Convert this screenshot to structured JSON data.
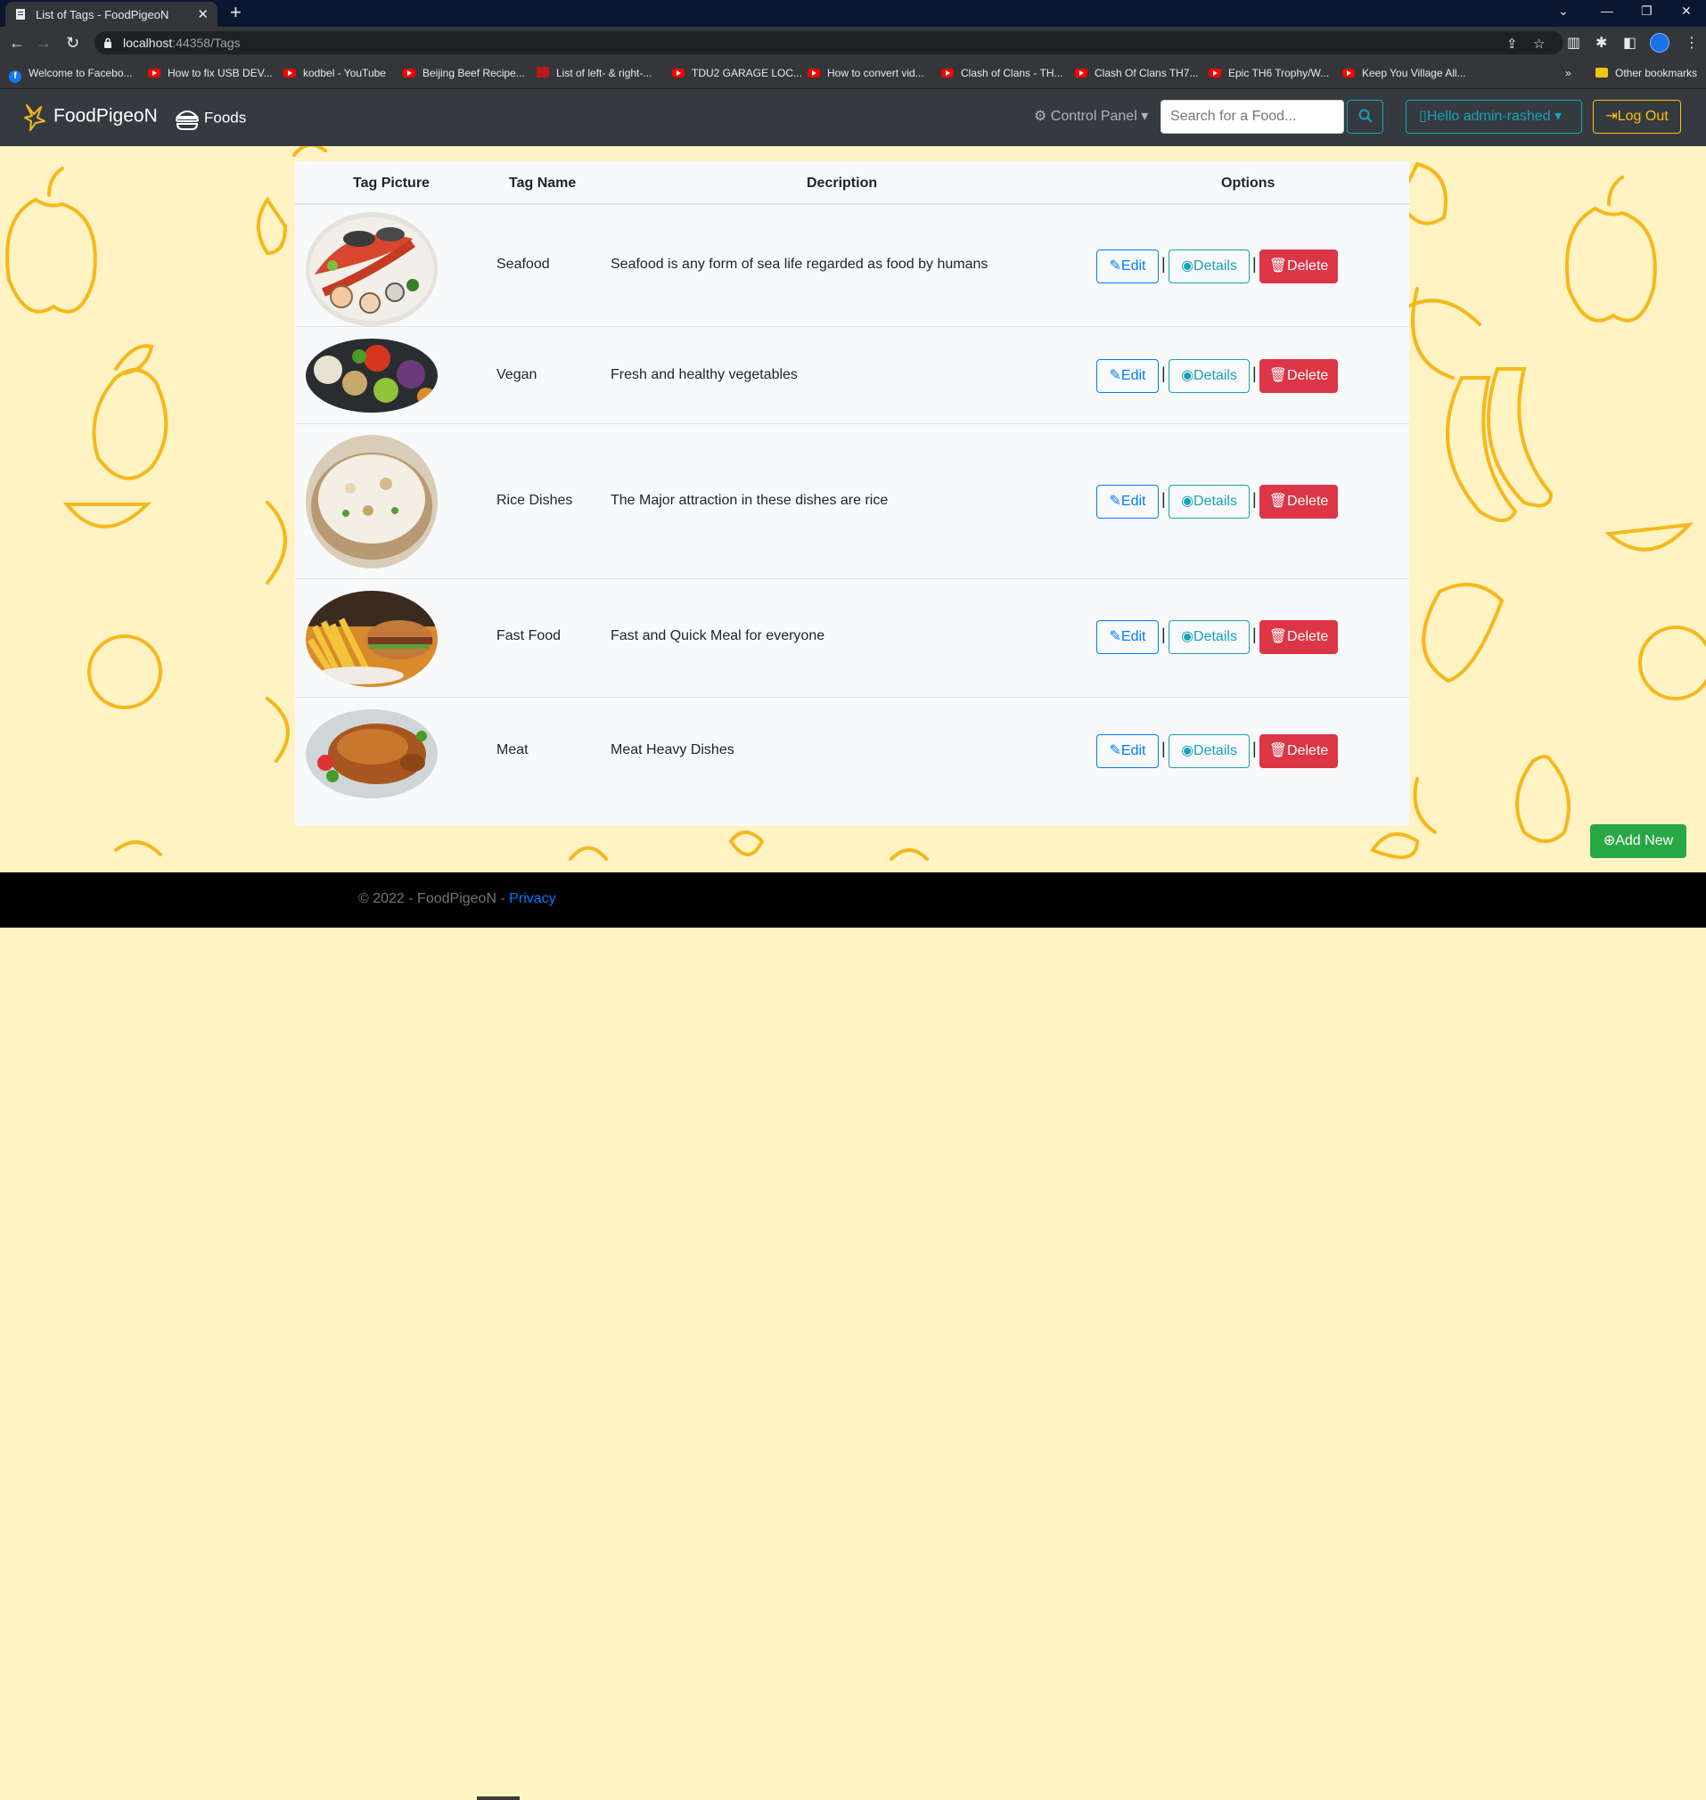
{
  "browser": {
    "tab_title": "List of Tags - FoodPigeoN",
    "url_host": "localhost",
    "url_rest": ":44358/Tags",
    "bookmarks": [
      {
        "label": "Welcome to Facebo...",
        "icon": "facebook-icon"
      },
      {
        "label": "How to fix USB DEV...",
        "icon": "youtube-icon"
      },
      {
        "label": "kodbel - YouTube",
        "icon": "youtube-icon"
      },
      {
        "label": "Beijing Beef Recipe...",
        "icon": "youtube-icon"
      },
      {
        "label": "List of left- & right-...",
        "icon": "page-icon"
      },
      {
        "label": "TDU2 GARAGE LOC...",
        "icon": "youtube-icon"
      },
      {
        "label": "How to convert vid...",
        "icon": "youtube-icon"
      },
      {
        "label": "Clash of Clans - TH...",
        "icon": "youtube-icon"
      },
      {
        "label": "Clash Of Clans TH7...",
        "icon": "youtube-icon"
      },
      {
        "label": "Epic TH6 Trophy/W...",
        "icon": "youtube-icon"
      },
      {
        "label": "Keep You Village All...",
        "icon": "youtube-icon"
      }
    ],
    "other_bookmarks": "Other bookmarks"
  },
  "navbar": {
    "brand": "FoodPigeoN",
    "foods_link": "Foods",
    "control_panel": "Control Panel",
    "search_placeholder": "Search for a Food...",
    "user_menu": "Hello admin-rashed",
    "logout": "Log Out"
  },
  "table": {
    "headers": {
      "picture": "Tag Picture",
      "name": "Tag Name",
      "description": "Decription",
      "options": "Options"
    },
    "rows": [
      {
        "name": "Seafood",
        "description": "Seafood is any form of sea life regarded as food by humans",
        "image": "seafood-platter"
      },
      {
        "name": "Vegan",
        "description": "Fresh and healthy vegetables",
        "image": "vegetable-bowls"
      },
      {
        "name": "Rice Dishes",
        "description": "The Major attraction in these dishes are rice",
        "image": "rice-bowl"
      },
      {
        "name": "Fast Food",
        "description": "Fast and Quick Meal for everyone",
        "image": "fries-burger"
      },
      {
        "name": "Meat",
        "description": "Meat Heavy Dishes",
        "image": "roast-chicken"
      }
    ],
    "actions": {
      "edit": "Edit",
      "details": "Details",
      "delete": "Delete",
      "separator": "|"
    }
  },
  "add_new": "Add New",
  "footer": {
    "copyright": "© 2022 - FoodPigeoN - ",
    "privacy": "Privacy"
  },
  "colors": {
    "navbar_bg": "#343a40",
    "page_bg": "#fff3c4",
    "pattern": "#f5b81c",
    "primary": "#007bff",
    "info": "#17a2b8",
    "danger": "#dc3545",
    "success": "#28a745",
    "warning": "#ffc107"
  }
}
